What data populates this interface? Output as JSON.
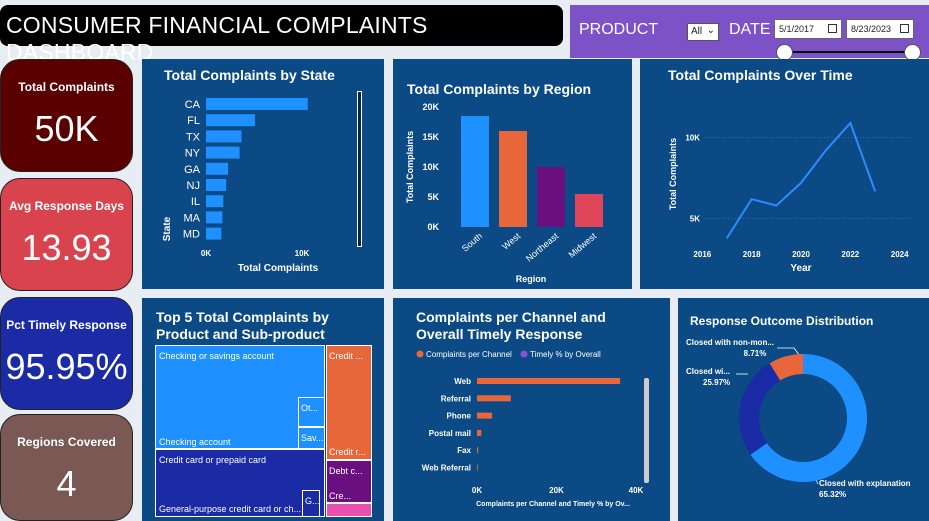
{
  "header": {
    "title": "CONSUMER FINANCIAL COMPLAINTS DASHBOARD"
  },
  "filters": {
    "product_label": "PRODUCT",
    "product_value": "All",
    "date_label": "DATE",
    "date_start": "5/1/2017",
    "date_end": "8/23/2023"
  },
  "kpis": [
    {
      "title": "Total Complaints",
      "value": "50K",
      "color": "#5b0000"
    },
    {
      "title": "Avg Response Days",
      "value": "13.93",
      "color": "#d9434e"
    },
    {
      "title": "Pct Timely Response",
      "value": "95.95%",
      "color": "#1b2aa5"
    },
    {
      "title": "Regions Covered",
      "value": "4",
      "color": "#7a5853"
    }
  ],
  "state_chart": {
    "title": "Total Complaints by State",
    "ylabel": "State",
    "xlabel": "Total Complaints",
    "ticks": [
      "0K",
      "10K"
    ]
  },
  "region_chart": {
    "title": "Total Complaints by Region",
    "ylabel": "Total Complaints",
    "xlabel": "Region",
    "ticks": [
      "0K",
      "5K",
      "10K",
      "15K",
      "20K"
    ]
  },
  "time_chart": {
    "title": "Total Complaints Over Time",
    "ylabel": "Total Complaints",
    "xlabel": "Year",
    "yticks": [
      "5K",
      "10K"
    ],
    "xticks": [
      "2016",
      "2018",
      "2020",
      "2022",
      "2024"
    ]
  },
  "treemap": {
    "title_line1": "Top 5 Total Complaints by",
    "title_line2": "Product and Sub-product",
    "labels": {
      "checking": "Checking or savings account",
      "checking_sub": "Checking account",
      "ot": "Ot...",
      "sav": "Sav...",
      "credit_card": "Credit card or prepaid card",
      "credit_card_sub": "General-purpose credit card or ch...",
      "g": "G...",
      "credit_rep": "Credit ...",
      "credit_rep_sub": "Credit r...",
      "debt": "Debt c...",
      "cre": "Cre..."
    }
  },
  "channel_chart": {
    "title_line1": "Complaints per Channel and",
    "title_line2": "Overall Timely Response",
    "legend": [
      "Complaints per Channel",
      "Timely % by Overall"
    ],
    "xlabel": "Complaints per Channel and Timely % by Ov...",
    "ticks": [
      "0K",
      "20K",
      "40K"
    ]
  },
  "donut": {
    "title": "Response Outcome Distribution",
    "labels": {
      "nonmon": "Closed with non-mon...",
      "nonmon_pct": "8.71%",
      "relief": "Closed wi...",
      "relief_pct": "25.97%",
      "explanation": "Closed with explanation",
      "explanation_pct": "65.32%"
    }
  },
  "chart_data": [
    {
      "type": "bar",
      "title": "Total Complaints by State",
      "categories": [
        "CA",
        "FL",
        "TX",
        "NY",
        "GA",
        "NJ",
        "IL",
        "MA",
        "MD"
      ],
      "values": [
        10600,
        5100,
        3700,
        3500,
        2300,
        2100,
        1800,
        1700,
        1600
      ],
      "xlabel": "Total Complaints",
      "ylabel": "State",
      "xlim": [
        0,
        15000
      ]
    },
    {
      "type": "bar",
      "title": "Total Complaints by Region",
      "categories": [
        "South",
        "West",
        "Northeast",
        "Midwest"
      ],
      "values": [
        18500,
        16000,
        10000,
        5500
      ],
      "colors": [
        "#1e90ff",
        "#e8673a",
        "#6a0f7f",
        "#e0455a"
      ],
      "xlabel": "Region",
      "ylabel": "Total Complaints",
      "ylim": [
        0,
        20000
      ]
    },
    {
      "type": "line",
      "title": "Total Complaints Over Time",
      "x": [
        2017,
        2018,
        2019,
        2020,
        2021,
        2022,
        2023
      ],
      "values": [
        3800,
        6200,
        5800,
        7200,
        9200,
        10900,
        6700
      ],
      "xlabel": "Year",
      "ylabel": "Total Complaints",
      "xlim": [
        2015.5,
        2024.5
      ],
      "ylim": [
        2500,
        13000
      ]
    },
    {
      "type": "bar",
      "title": "Complaints per Channel and Overall Timely Response",
      "categories": [
        "Web",
        "Referral",
        "Phone",
        "Postal mail",
        "Fax",
        "Web Referral"
      ],
      "series": [
        {
          "name": "Complaints per Channel",
          "values": [
            36000,
            8500,
            3800,
            1100,
            300,
            100
          ],
          "color": "#e8673a"
        },
        {
          "name": "Timely % by Overall",
          "values": [
            0.96,
            0.96,
            0.96,
            0.96,
            0.96,
            0.96
          ],
          "color": "#8b4fd1"
        }
      ],
      "xlim": [
        0,
        45000
      ]
    },
    {
      "type": "pie",
      "title": "Response Outcome Distribution",
      "categories": [
        "Closed with explanation",
        "Closed wi...",
        "Closed with non-mon..."
      ],
      "values": [
        65.32,
        25.97,
        8.71
      ],
      "colors": [
        "#1e90ff",
        "#1b2aa5",
        "#e8673a"
      ]
    }
  ]
}
